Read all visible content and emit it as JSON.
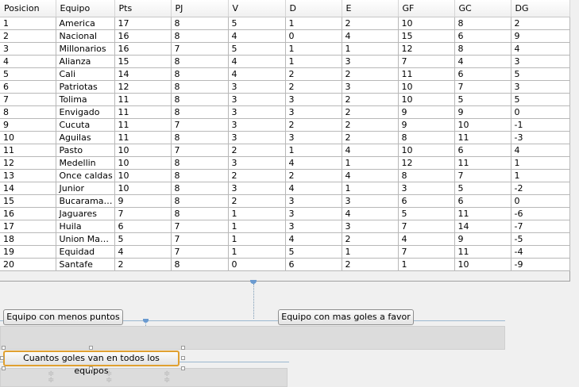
{
  "table": {
    "columns": [
      "Posicion",
      "Equipo",
      "Pts",
      "PJ",
      "V",
      "D",
      "E",
      "GF",
      "GC",
      "DG"
    ],
    "rows": [
      [
        "1",
        "America",
        "17",
        "8",
        "5",
        "1",
        "2",
        "10",
        "8",
        "2"
      ],
      [
        "2",
        "Nacional",
        "16",
        "8",
        "4",
        "0",
        "4",
        "15",
        "6",
        "9"
      ],
      [
        "3",
        "Millonarios",
        "16",
        "7",
        "5",
        "1",
        "1",
        "12",
        "8",
        "4"
      ],
      [
        "4",
        "Alianza",
        "15",
        "8",
        "4",
        "1",
        "3",
        "7",
        "4",
        "3"
      ],
      [
        "5",
        "Cali",
        "14",
        "8",
        "4",
        "2",
        "2",
        "11",
        "6",
        "5"
      ],
      [
        "6",
        "Patriotas",
        "12",
        "8",
        "3",
        "2",
        "3",
        "10",
        "7",
        "3"
      ],
      [
        "7",
        "Tolima",
        "11",
        "8",
        "3",
        "3",
        "2",
        "10",
        "5",
        "5"
      ],
      [
        "8",
        "Envigado",
        "11",
        "8",
        "3",
        "3",
        "2",
        "9",
        "9",
        "0"
      ],
      [
        "9",
        "Cucuta",
        "11",
        "7",
        "3",
        "2",
        "2",
        "9",
        "10",
        "-1"
      ],
      [
        "10",
        "Aguilas",
        "11",
        "8",
        "3",
        "3",
        "2",
        "8",
        "11",
        "-3"
      ],
      [
        "11",
        "Pasto",
        "10",
        "7",
        "2",
        "1",
        "4",
        "10",
        "6",
        "4"
      ],
      [
        "12",
        "Medellin",
        "10",
        "8",
        "3",
        "4",
        "1",
        "12",
        "11",
        "1"
      ],
      [
        "13",
        "Once caldas",
        "10",
        "8",
        "2",
        "2",
        "4",
        "8",
        "7",
        "1"
      ],
      [
        "14",
        "Junior",
        "10",
        "8",
        "3",
        "4",
        "1",
        "3",
        "5",
        "-2"
      ],
      [
        "15",
        "Bucaramanga",
        "9",
        "8",
        "2",
        "3",
        "3",
        "6",
        "6",
        "0"
      ],
      [
        "16",
        "Jaguares",
        "7",
        "8",
        "1",
        "3",
        "4",
        "5",
        "11",
        "-6"
      ],
      [
        "17",
        "Huila",
        "6",
        "7",
        "1",
        "3",
        "3",
        "7",
        "14",
        "-7"
      ],
      [
        "18",
        "Union Magd...",
        "5",
        "7",
        "1",
        "4",
        "2",
        "4",
        "9",
        "-5"
      ],
      [
        "19",
        "Equidad",
        "4",
        "7",
        "1",
        "5",
        "1",
        "7",
        "11",
        "-4"
      ],
      [
        "20",
        "Santafe",
        "2",
        "8",
        "0",
        "6",
        "2",
        "1",
        "10",
        "-9"
      ]
    ]
  },
  "buttons": {
    "menos_puntos": "Equipo con menos puntos",
    "mas_goles": "Equipo con mas goles a favor",
    "total_goles": "Cuantos goles van en todos los equipos"
  },
  "colors": {
    "selection": "#e0a030",
    "guide": "#9bb8d0"
  }
}
